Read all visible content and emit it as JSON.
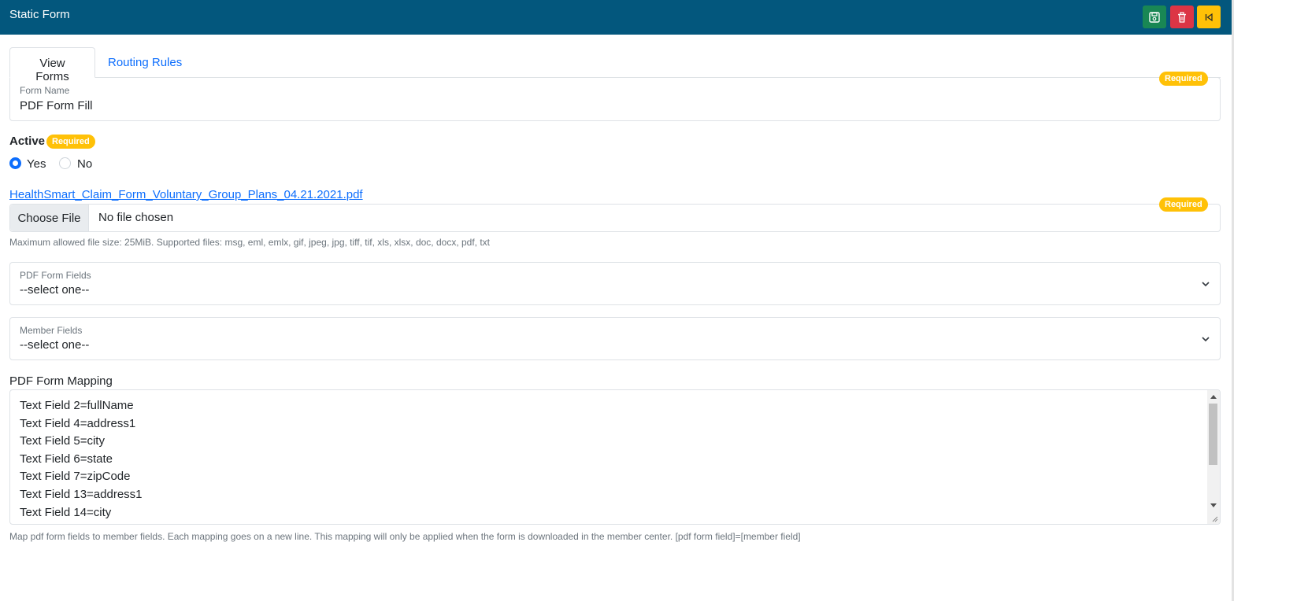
{
  "header": {
    "title": "Static Form"
  },
  "toolbar": {
    "save_icon": "floppy-disk-icon",
    "delete_icon": "trash-icon",
    "back_icon": "back-arrow-icon"
  },
  "colors": {
    "header_bg": "#03577d",
    "save": "#198754",
    "delete": "#dc3545",
    "back": "#ffc107",
    "link": "#0d6efd",
    "badge": "#ffc107"
  },
  "tabs": [
    {
      "label": "View Forms",
      "active": true
    },
    {
      "label": "Routing Rules",
      "active": false
    }
  ],
  "form_name": {
    "label": "Form Name",
    "value": "PDF Form Fill",
    "badge": "Required"
  },
  "active": {
    "label": "Active",
    "badge": "Required",
    "options": [
      {
        "label": "Yes",
        "checked": true
      },
      {
        "label": "No",
        "checked": false
      }
    ]
  },
  "file": {
    "current_file": "HealthSmart_Claim_Form_Voluntary_Group_Plans_04.21.2021.pdf",
    "button_label": "Choose File",
    "status": "No file chosen",
    "badge": "Required",
    "help": "Maximum allowed file size: 25MiB. Supported files: msg, eml, emlx, gif, jpeg, jpg, tiff, tif, xls, xlsx, doc, docx, pdf, txt"
  },
  "pdf_form_fields": {
    "label": "PDF Form Fields",
    "value": "--select one--"
  },
  "member_fields": {
    "label": "Member Fields",
    "value": "--select one--"
  },
  "mapping": {
    "label": "PDF Form Mapping",
    "lines": [
      "Text Field 2=fullName",
      "Text Field 4=address1",
      "Text Field 5=city",
      "Text Field 6=state",
      "Text Field 7=zipCode",
      "Text Field 13=address1",
      "Text Field 14=city"
    ],
    "help": "Map pdf form fields to member fields. Each mapping goes on a new line. This mapping will only be applied when the form is downloaded in the member center. [pdf form field]=[member field]"
  }
}
